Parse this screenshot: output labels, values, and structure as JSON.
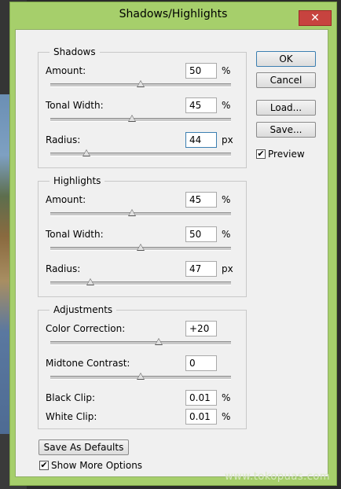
{
  "window": {
    "title": "Shadows/Highlights",
    "close_label": "✕"
  },
  "shadows": {
    "title": "Shadows",
    "amount": {
      "label": "Amount:",
      "value": "50",
      "unit": "%",
      "level": 0.5
    },
    "tonal_width": {
      "label": "Tonal Width:",
      "value": "45",
      "unit": "%",
      "level": 0.45
    },
    "radius": {
      "label": "Radius:",
      "value": "44",
      "unit": "px",
      "level": 0.2
    }
  },
  "highlights": {
    "title": "Highlights",
    "amount": {
      "label": "Amount:",
      "value": "45",
      "unit": "%",
      "level": 0.45
    },
    "tonal_width": {
      "label": "Tonal Width:",
      "value": "50",
      "unit": "%",
      "level": 0.5
    },
    "radius": {
      "label": "Radius:",
      "value": "47",
      "unit": "px",
      "level": 0.22
    }
  },
  "adjustments": {
    "title": "Adjustments",
    "color_correction": {
      "label": "Color Correction:",
      "value": "+20",
      "level": 0.6
    },
    "midtone_contrast": {
      "label": "Midtone Contrast:",
      "value": "0",
      "level": 0.5
    },
    "black_clip": {
      "label": "Black Clip:",
      "value": "0.01",
      "unit": "%"
    },
    "white_clip": {
      "label": "White Clip:",
      "value": "0.01",
      "unit": "%"
    }
  },
  "buttons": {
    "ok": "OK",
    "cancel": "Cancel",
    "load": "Load...",
    "save": "Save...",
    "save_defaults": "Save As Defaults"
  },
  "preview": {
    "label": "Preview",
    "checked": true
  },
  "show_more": {
    "label": "Show More Options",
    "checked": true
  },
  "watermark": "www.tokopuas.com",
  "colors": {
    "frame": "#a6cf6b",
    "close": "#c7433f",
    "focus": "#3c7fb1"
  }
}
